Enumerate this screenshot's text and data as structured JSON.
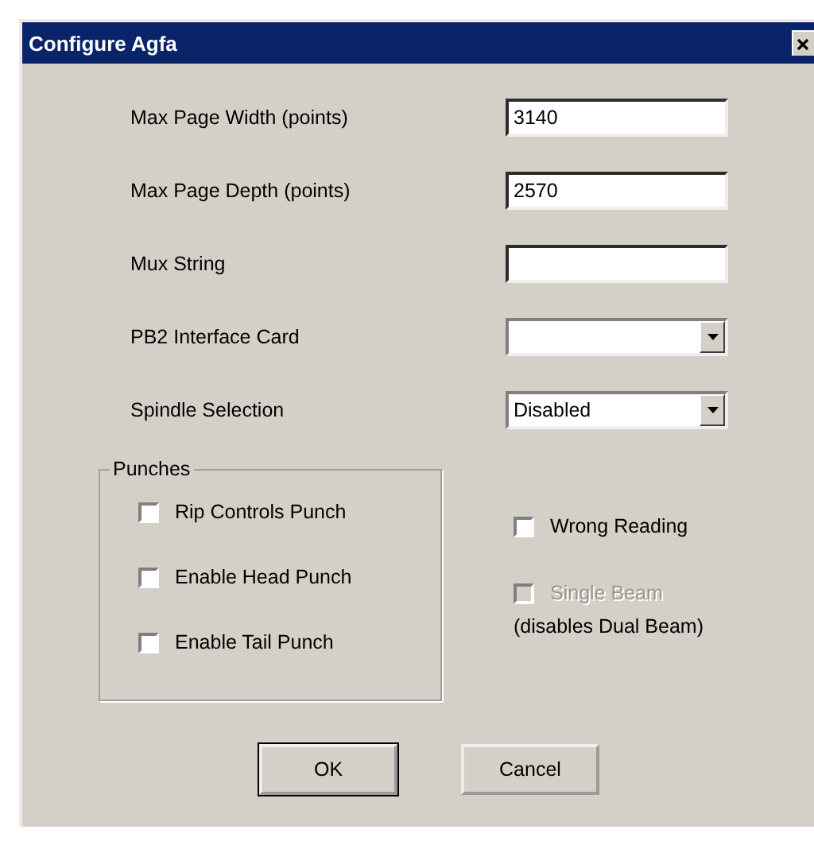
{
  "window": {
    "title": "Configure Agfa"
  },
  "fields": [
    {
      "kind": "text",
      "label": "Max Page Width (points)",
      "value": "3140"
    },
    {
      "kind": "text",
      "label": "Max Page Depth (points)",
      "value": "2570"
    },
    {
      "kind": "text",
      "label": "Mux String"
    },
    {
      "kind": "dropdown",
      "label": "PB2 Interface Card"
    },
    {
      "kind": "dropdown",
      "label": "Spindle Selection",
      "value": "Disabled"
    }
  ],
  "punches": {
    "title": "Punches",
    "options": [
      {
        "label": "Rip Controls Punch",
        "checked": false
      },
      {
        "label": "Enable Head Punch",
        "checked": false
      },
      {
        "label": "Enable Tail Punch",
        "checked": false
      }
    ]
  },
  "options": [
    {
      "label": "Wrong Reading",
      "checked": false,
      "disabled": false
    },
    {
      "label": "Single Beam",
      "checked": false,
      "disabled": true
    }
  ],
  "note": "(disables Dual Beam)",
  "buttons": [
    {
      "label": "OK",
      "default": true
    },
    {
      "label": "Cancel",
      "default": false
    }
  ]
}
